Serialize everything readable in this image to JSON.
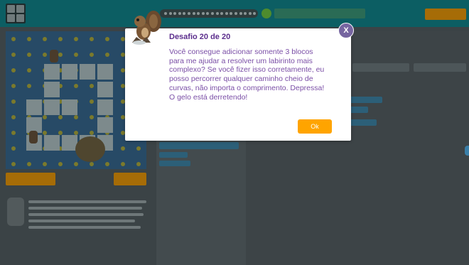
{
  "dialog": {
    "title": "Desafio 20 de 20",
    "message": "Você consegue adicionar somente 3 blocos para me ajudar a resolver um labirinto mais complexo? Se você fizer isso corretamente, eu posso percorrer qualquer caminho cheio de curvas, não importa o comprimento. Depressa! O gelo está derretendo!",
    "ok_label": "Ok",
    "close_label": "X",
    "avatar_icon": "squirrel-character-icon"
  },
  "colors": {
    "dialog_title": "#5b2d8c",
    "dialog_text": "#7a4ea6",
    "ok_button": "#ffa400",
    "close_button": "#7665a0",
    "overlay_background": "#3b4346"
  }
}
